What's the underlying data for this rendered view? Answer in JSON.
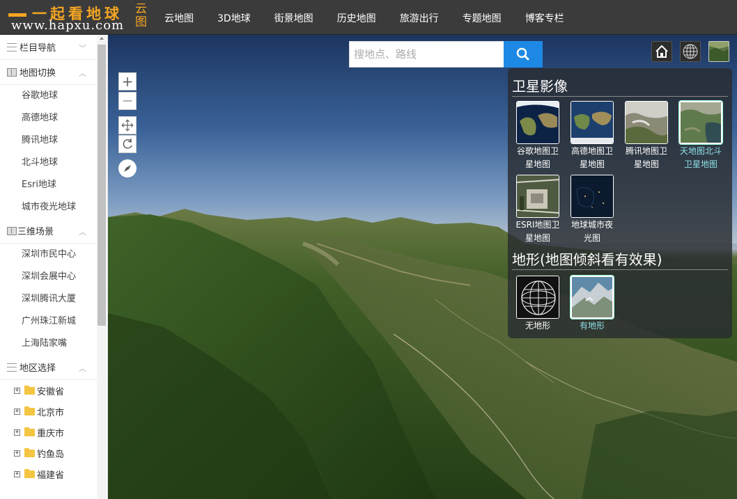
{
  "header": {
    "logo_top": "一起看地球",
    "logo_bottom": "www.hapxu.com",
    "logo_side": "云图",
    "nav": [
      "云地图",
      "3D地球",
      "街景地图",
      "历史地图",
      "旅游出行",
      "专题地图",
      "博客专栏"
    ]
  },
  "sidebar": {
    "section_nav": "栏目导航",
    "section_map": "地图切换",
    "map_items": [
      "谷歌地球",
      "高德地球",
      "腾讯地球",
      "北斗地球",
      "Esri地球",
      "城市夜光地球"
    ],
    "section_3d": "三维场景",
    "scene_items": [
      "深圳市民中心",
      "深圳会展中心",
      "深圳腾讯大厦",
      "广州珠江新城",
      "上海陆家嘴"
    ],
    "section_region": "地区选择",
    "regions": [
      "安徽省",
      "北京市",
      "重庆市",
      "钓鱼岛",
      "福建省"
    ]
  },
  "map": {
    "search_placeholder": "搜地点、路线",
    "zoom_in": "+",
    "zoom_out": "—",
    "panel": {
      "satellite_title": "卫星影像",
      "satellite": [
        {
          "label1": "谷歌地图卫",
          "label2": "星地图"
        },
        {
          "label1": "高德地图卫",
          "label2": "星地图"
        },
        {
          "label1": "腾讯地图卫",
          "label2": "星地图"
        },
        {
          "label1": "天地图北斗",
          "label2": "卫星地图",
          "selected": true
        },
        {
          "label1": "ESRI地图卫",
          "label2": "星地图"
        },
        {
          "label1": "地球城市夜",
          "label2": "光图"
        }
      ],
      "terrain_title": "地形(地图倾斜看有效果)",
      "terrain": [
        {
          "label": "无地形"
        },
        {
          "label": "有地形",
          "selected": true
        }
      ]
    }
  },
  "colors": {
    "header_bg": "#3b3b3b",
    "logo_accent": "#f5a623",
    "search_button": "#1e88e5",
    "selected_label": "#8fe0e8"
  }
}
